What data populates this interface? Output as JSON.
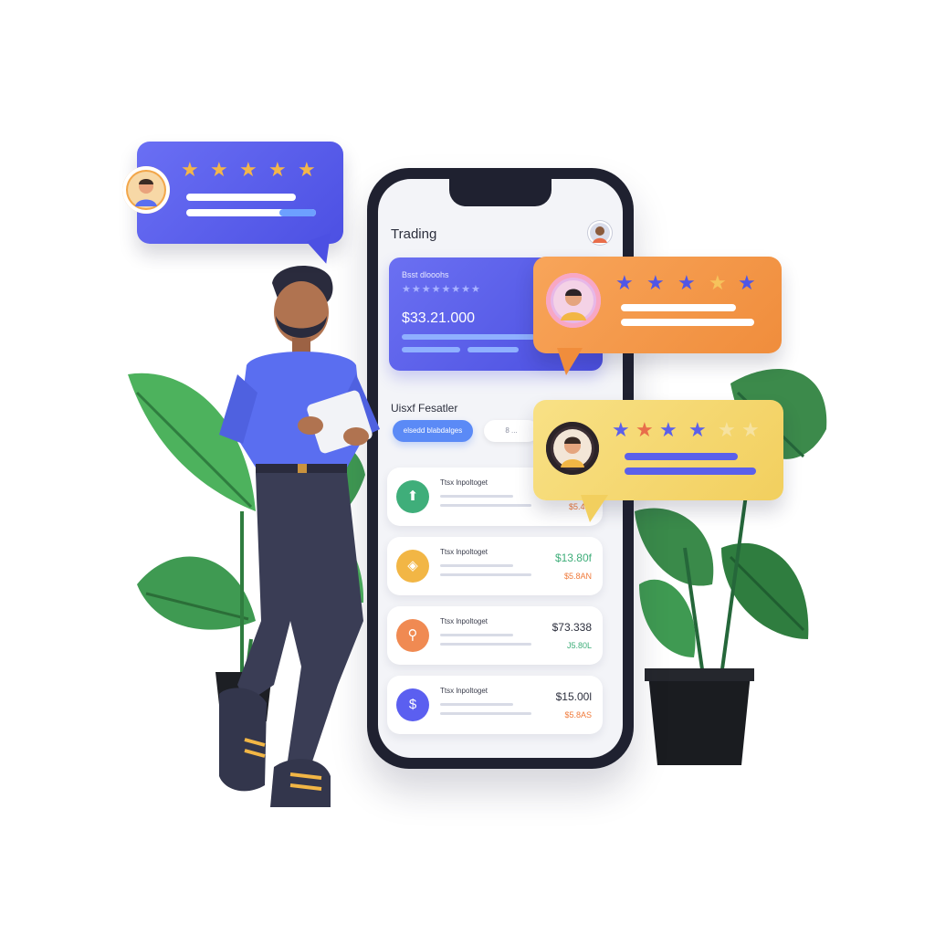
{
  "phone": {
    "app_title": "Trading",
    "balance_card": {
      "label": "Bsst dlooohs",
      "stars": "★★★★★★★★",
      "amount": "$33.21.000"
    },
    "section_title": "Uisxf Fesatler",
    "chips": [
      "elsedd blabdalges",
      "8 ..."
    ],
    "rows": [
      {
        "title": "Ttsx lnpoltoget",
        "amount": "",
        "sub": "$5.48.",
        "icon": "dollar-tag-icon",
        "color": "#3fae7a",
        "sub_color": "#f07a3a"
      },
      {
        "title": "Ttsx lnpoltoget",
        "amount": "$13.80f",
        "sub": "$5.8AN",
        "icon": "coins-icon",
        "color": "#f2b645",
        "sub_color": "#f07a3a"
      },
      {
        "title": "Ttsx lnpoltoget",
        "amount": "$73.338",
        "sub": "J5.80L",
        "icon": "stock-icon",
        "color": "#f08a52",
        "sub_color": "#3fae7a"
      },
      {
        "title": "Ttsx lnpoltoget",
        "amount": "$15.00l",
        "sub": "$5.8AS",
        "icon": "dollar-icon",
        "color": "#5b5ff0",
        "sub_color": "#f07a3a"
      }
    ]
  },
  "bubbles": {
    "blue": {
      "stars": 5,
      "star_color": "#f4b64a"
    },
    "orange": {
      "stars": 5,
      "star_color": "#4f56e6"
    },
    "yellow": {
      "stars": 5,
      "star_color": "#5b60ea"
    }
  },
  "colors": {
    "brand_blue": "#4c50e3",
    "bubble_orange": "#f08d3c",
    "bubble_yellow": "#f2cf5e",
    "plant_green": "#3f9a52",
    "shirt_blue": "#5a6ef0"
  }
}
